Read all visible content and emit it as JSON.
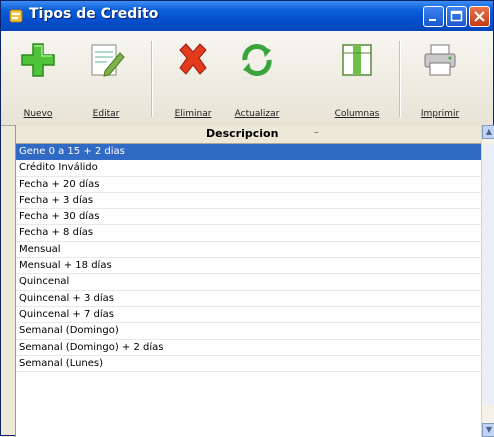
{
  "window": {
    "title": "Tipos de Credito"
  },
  "toolbar": {
    "buttons": [
      {
        "label": "Nuevo",
        "icon": "plus-icon"
      },
      {
        "label": "Editar",
        "icon": "edit-icon"
      },
      {
        "label": "Eliminar",
        "icon": "delete-x-icon"
      },
      {
        "label": "Actualizar",
        "icon": "refresh-icon"
      },
      {
        "label": "Columnas",
        "icon": "columns-icon"
      },
      {
        "label": "Imprimir",
        "icon": "printer-icon"
      }
    ]
  },
  "list": {
    "header": "Descripcion",
    "sort_indicator": "–",
    "selected_index": 0,
    "rows": [
      "Gene 0 a 15 + 2 dias",
      "Crédito Inválido",
      "Fecha + 20 días",
      "Fecha + 3 días",
      "Fecha + 30 días",
      "Fecha + 8 días",
      "Mensual",
      "Mensual + 18 días",
      "Quincenal",
      "Quincenal + 3 días",
      "Quincenal + 7 días",
      "Semanal (Domingo)",
      "Semanal (Domingo) + 2 días",
      "Semanal (Lunes)"
    ]
  },
  "colors": {
    "title_bar": "#0a5fd8",
    "selection": "#316ac5",
    "close_button": "#c33a14"
  }
}
